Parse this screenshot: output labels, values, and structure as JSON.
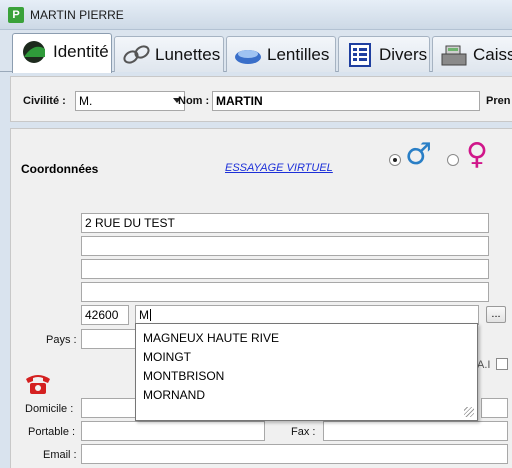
{
  "window": {
    "title": "MARTIN PIERRE",
    "app_icon_letter": "P"
  },
  "tabs": [
    {
      "label": "Identité",
      "icon": "identity-icon",
      "active": true
    },
    {
      "label": "Lunettes",
      "icon": "glasses-icon",
      "active": false
    },
    {
      "label": "Lentilles",
      "icon": "lens-icon",
      "active": false
    },
    {
      "label": "Divers",
      "icon": "list-icon",
      "active": false
    },
    {
      "label": "Caiss",
      "icon": "cash-register-icon",
      "active": false
    }
  ],
  "identity": {
    "civilite_label": "Civilité :",
    "civilite_value": "M.",
    "nom_label": "Nom :",
    "nom_value": "MARTIN",
    "prenom_label_partial": "Pren"
  },
  "coordonnees": {
    "title": "Coordonnées",
    "virtual_link": "ESSAYAGE VIRTUEL",
    "gender_male_selected": true,
    "male_symbol": "♂",
    "female_symbol": "♀",
    "address_lines": [
      "2 RUE DU TEST",
      "",
      "",
      ""
    ],
    "postal_code": "42600",
    "city_input": "M",
    "browse_button": "...",
    "pays_label": "Pays :",
    "partial_checkbox_label": "A.I",
    "domicile_label": "Domicile :",
    "portable_label": "Portable :",
    "fax_label": "Fax :",
    "email_label": "Email :"
  },
  "city_suggestions": [
    "MAGNEUX HAUTE RIVE",
    "MOINGT",
    "MONTBRISON",
    "MORNAND"
  ],
  "colors": {
    "link": "#1c2fd8",
    "male": "#2a7fc6",
    "female": "#d0168a",
    "phone": "#d42020"
  }
}
